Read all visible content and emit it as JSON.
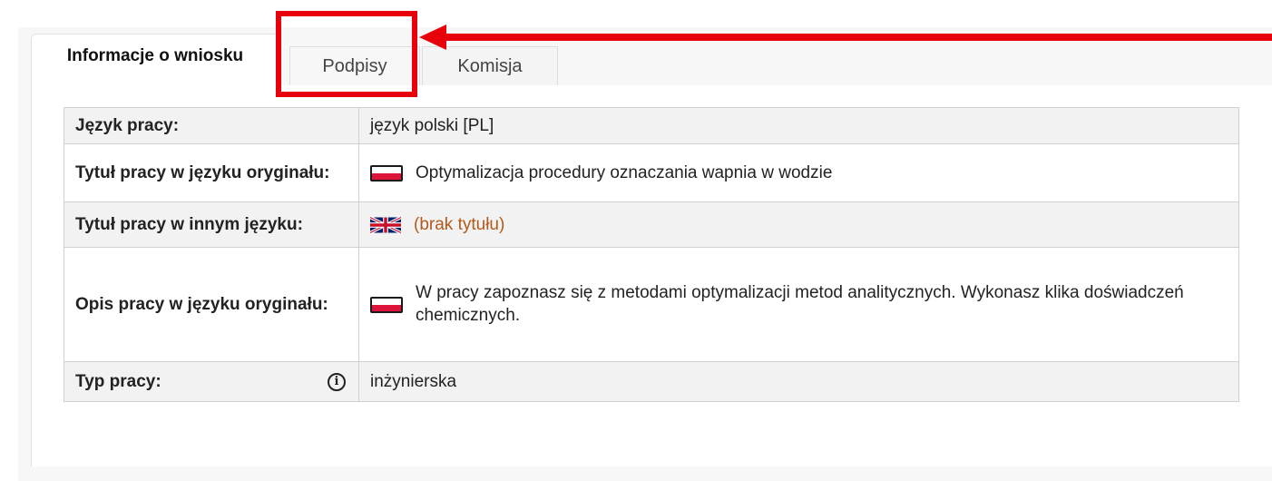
{
  "tabs": [
    {
      "label": "Informacje o wniosku",
      "active": true
    },
    {
      "label": "Podpisy",
      "active": false
    },
    {
      "label": "Komisja",
      "active": false
    }
  ],
  "rows": [
    {
      "label": "Język pracy:",
      "value": "język polski [PL]",
      "flag": "none"
    },
    {
      "label": "Tytuł pracy w języku oryginału:",
      "value": "Optymalizacja procedury oznaczania wapnia w wodzie",
      "flag": "pl-flag"
    },
    {
      "label": "Tytuł pracy w innym języku:",
      "value": "(brak tytułu)",
      "flag": "uk-flag"
    },
    {
      "label": "Opis pracy w języku oryginału:",
      "value": "W pracy zapoznasz się z metodami optymalizacji metod analitycznych. Wykonasz klika doświadczeń chemicznych.",
      "flag": "pl-flag"
    },
    {
      "label": "Typ pracy:",
      "value": "inżynierska",
      "flag": "none",
      "icon": "info-icon"
    }
  ],
  "colors": {
    "annotation": "#e8000b",
    "missing_title": "#b05a1c"
  }
}
